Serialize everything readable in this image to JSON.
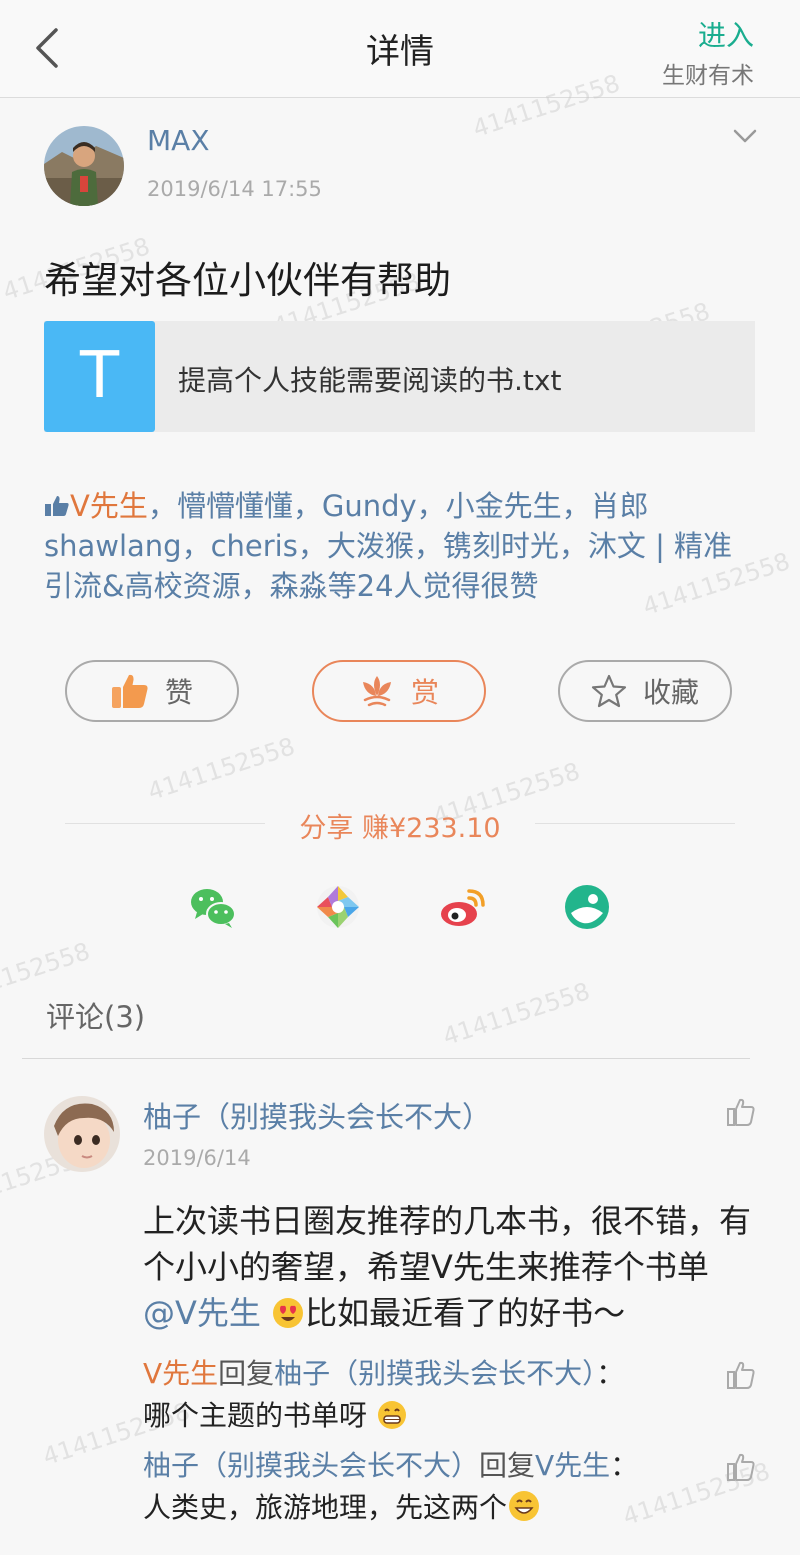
{
  "header": {
    "title": "详情",
    "enter_label": "进入",
    "circle_name": "生财有术"
  },
  "watermark": "4141152558",
  "post": {
    "author": "MAX",
    "time": "2019/6/14 17:55",
    "text": "希望对各位小伙伴有帮助",
    "attachment": {
      "icon_letter": "T",
      "file_name": "提高个人技能需要阅读的书.txt"
    },
    "likes": {
      "first": "V先生",
      "rest": "，懵懵懂懂，Gundy，小金先生，肖郎shawlang，cheris，大泼猴，镌刻时光，沐文 | 精准引流&高校资源，森淼等24人觉得很赞"
    }
  },
  "actions": {
    "like_label": "赞",
    "reward_label": "赏",
    "collect_label": "收藏"
  },
  "share": {
    "label": "分享 赚¥233.10",
    "targets": [
      "wechat-icon",
      "moments-icon",
      "weibo-icon",
      "qzone-icon"
    ]
  },
  "comments": {
    "title": "评论(3)",
    "items": [
      {
        "author": "柚子（别摸我头会长不大）",
        "date": "2019/6/14",
        "text_before": "上次读书日圈友推荐的几本书，很不错，有个小小的奢望，希望V先生来推荐个书单",
        "mention": "@V先生",
        "text_after": "比如最近看了的好书～",
        "replies": [
          {
            "from": "V先生",
            "verb": "回复",
            "to": "柚子（别摸我头会长不大）",
            "colon": "：",
            "text": "哪个主题的书单呀"
          },
          {
            "from": "柚子（别摸我头会长不大）",
            "verb": "回复",
            "to": "V先生",
            "colon": "：",
            "text": "人类史，旅游地理，先这两个"
          }
        ]
      }
    ]
  },
  "colors": {
    "link_blue": "#5a7fa6",
    "accent_orange": "#e9865a",
    "enter_green": "#1aad8f",
    "file_icon_blue": "#4ab8f5"
  }
}
